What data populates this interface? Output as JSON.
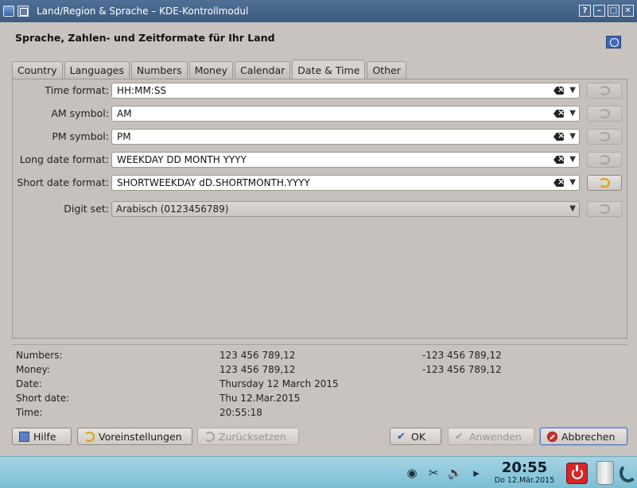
{
  "window": {
    "title": "Land/Region & Sprache – KDE-Kontrollmodul",
    "help_btn": "?",
    "min_btn": "–",
    "max_btn": "□",
    "close_btn": "✕"
  },
  "header": {
    "title": "Sprache, Zahlen- und Zeitformate für Ihr Land"
  },
  "tabs": [
    {
      "label": "Country"
    },
    {
      "label": "Languages"
    },
    {
      "label": "Numbers"
    },
    {
      "label": "Money"
    },
    {
      "label": "Calendar"
    },
    {
      "label": "Date & Time",
      "active": true
    },
    {
      "label": "Other"
    }
  ],
  "form": {
    "time_format": {
      "label": "Time format:",
      "value": "HH:MM:SS"
    },
    "am_symbol": {
      "label": "AM symbol:",
      "value": "AM"
    },
    "pm_symbol": {
      "label": "PM symbol:",
      "value": "PM"
    },
    "long_date": {
      "label": "Long date format:",
      "value": "WEEKDAY DD MONTH YYYY"
    },
    "short_date": {
      "label": "Short date format:",
      "value": "SHORTWEEKDAY dD.SHORTMONTH.YYYY"
    },
    "digit_set": {
      "label": "Digit set:",
      "value": "Arabisch (0123456789)"
    }
  },
  "preview": [
    {
      "key": "Numbers:",
      "v1": "123 456 789,12",
      "v2": "-123 456 789,12"
    },
    {
      "key": "Money:",
      "v1": "123 456 789,12",
      "v2": "-123 456 789,12"
    },
    {
      "key": "Date:",
      "v1": "Thursday 12 March 2015",
      "v2": ""
    },
    {
      "key": "Short date:",
      "v1": "Thu 12.Mar.2015",
      "v2": ""
    },
    {
      "key": "Time:",
      "v1": "20:55:18",
      "v2": ""
    }
  ],
  "buttons": {
    "help": "Hilfe",
    "defaults": "Voreinstellungen",
    "reset": "Zurücksetzen",
    "ok": "OK",
    "apply": "Anwenden",
    "cancel": "Abbrechen"
  },
  "taskbar": {
    "clock_time": "20:55",
    "clock_date": "Do 12.Mär.2015"
  }
}
